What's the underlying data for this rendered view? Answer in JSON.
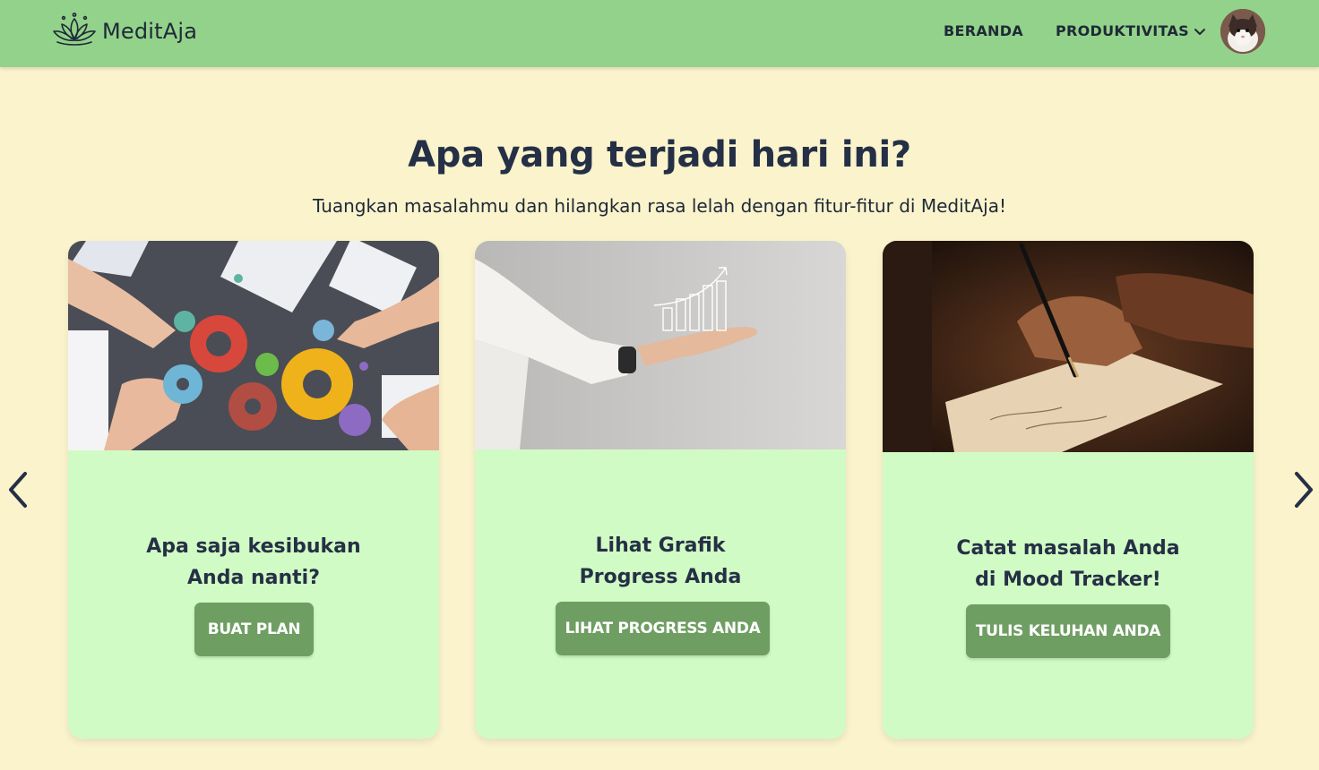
{
  "app": {
    "name": "MeditAja"
  },
  "nav": {
    "home": "BERANDA",
    "productivity": "PRODUKTIVITAS"
  },
  "hero": {
    "title": "Apa yang terjadi hari ini?",
    "subtitle": "Tuangkan masalahmu dan hilangkan rasa lelah dengan fitur-fitur di MeditAja!"
  },
  "cards": [
    {
      "line1": "Apa saja kesibukan",
      "line2": "Anda nanti?",
      "button": "BUAT PLAN",
      "image": "gears-teamwork-photo"
    },
    {
      "line1": "Lihat Grafik",
      "line2": "Progress Anda",
      "button": "LIHAT PROGRESS ANDA",
      "image": "hand-growth-chart-photo"
    },
    {
      "line1": "Catat masalah Anda",
      "line2": "di Mood Tracker!",
      "button": "TULIS KELUHAN ANDA",
      "image": "hand-writing-pen-photo"
    }
  ],
  "colors": {
    "navbar": "#93d28a",
    "background": "#faf3cc",
    "card": "#d1fbc4",
    "button": "#6f9e63",
    "heading": "#253046"
  },
  "icons": [
    "lotus-logo-icon",
    "chevron-down-icon",
    "chevron-left-icon",
    "chevron-right-icon"
  ]
}
